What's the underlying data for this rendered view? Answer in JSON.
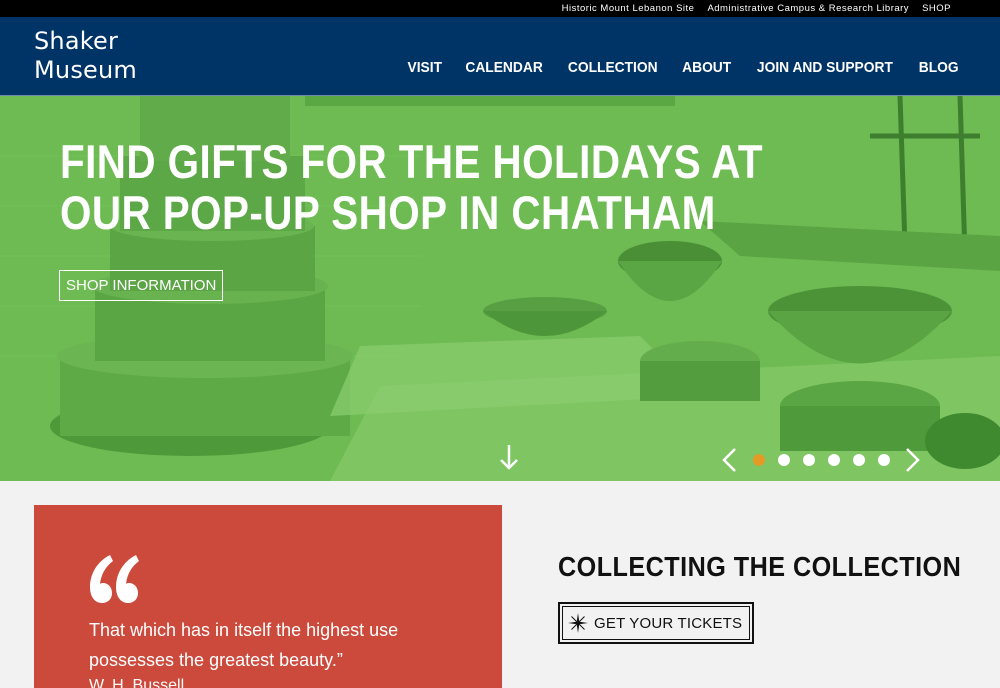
{
  "utility_nav": {
    "items": [
      "Historic Mount Lebanon Site",
      "Administrative Campus & Research Library",
      "SHOP"
    ]
  },
  "header": {
    "logo_line1": "Shaker",
    "logo_line2": "Museum",
    "nav": [
      "VISIT",
      "CALENDAR",
      "COLLECTION",
      "ABOUT",
      "JOIN AND SUPPORT",
      "BLOG"
    ]
  },
  "hero": {
    "title": "FIND GIFTS FOR THE HOLIDAYS AT OUR POP-UP SHOP IN CHATHAM",
    "button_label": "SHOP INFORMATION",
    "overlay_color": "#6dbb52",
    "carousel": {
      "slide_count": 6,
      "active_index": 0,
      "active_color": "#e59a26"
    }
  },
  "quote": {
    "text": "That which has in itself the highest use possesses the greatest beauty.”",
    "author": "W. H. Bussell",
    "panel_color": "#cc4a3c"
  },
  "feature": {
    "title": "COLLECTING THE COLLECTION",
    "ticket_label": "GET YOUR TICKETS"
  },
  "colors": {
    "header_bg": "#003366",
    "utility_bg": "#000000",
    "page_bg": "#f2f2f2"
  }
}
